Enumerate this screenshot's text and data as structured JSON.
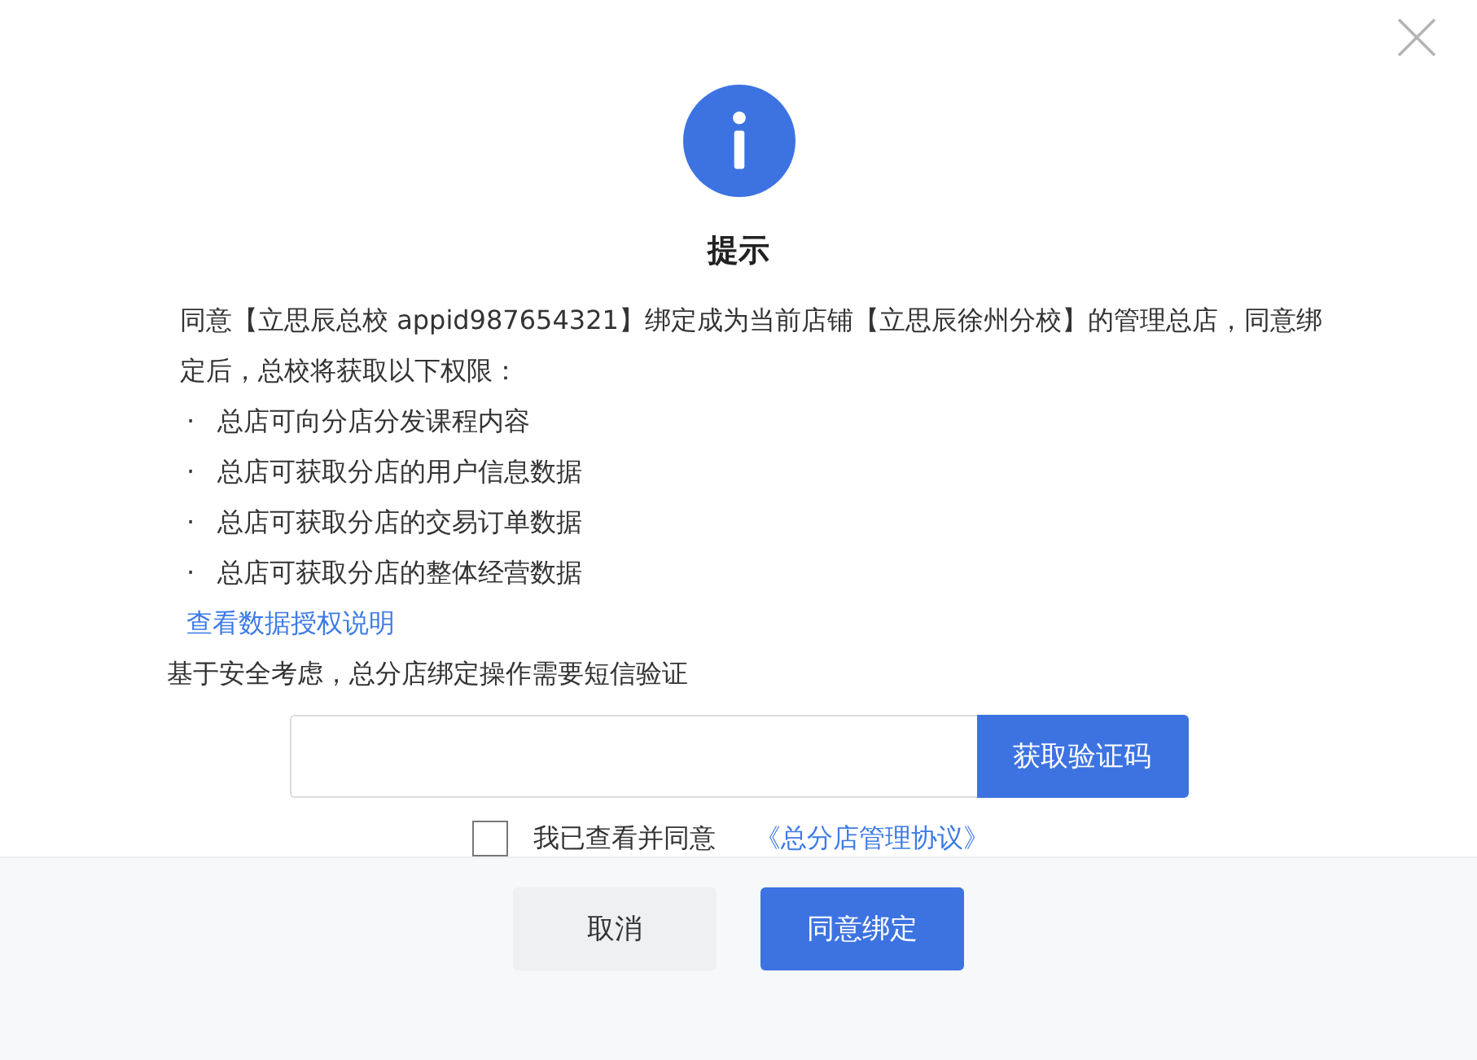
{
  "dialog": {
    "title": "提示",
    "message": "同意【立思辰总校 appid987654321】绑定成为当前店铺【立思辰徐州分校】的管理总店，同意绑定后，总校将获取以下权限：",
    "permissions": [
      {
        "bullet": "·",
        "text": "总店可向分店分发课程内容"
      },
      {
        "bullet": "·",
        "text": "总店可获取分店的用户信息数据"
      },
      {
        "bullet": "·",
        "text": "总店可获取分店的交易订单数据"
      },
      {
        "bullet": "·",
        "text": "总店可获取分店的整体经营数据"
      }
    ],
    "link": "查看数据授权说明",
    "security_note": "基于安全考虑，总分店绑定操作需要短信验证",
    "code_button": "获取验证码",
    "agree": {
      "checked": false,
      "label": "我已查看并同意",
      "link": "《总分店管理协议》"
    },
    "buttons": [
      {
        "label": "取消",
        "kind": "secondary"
      },
      {
        "label": "同意绑定",
        "kind": "primary"
      }
    ]
  }
}
